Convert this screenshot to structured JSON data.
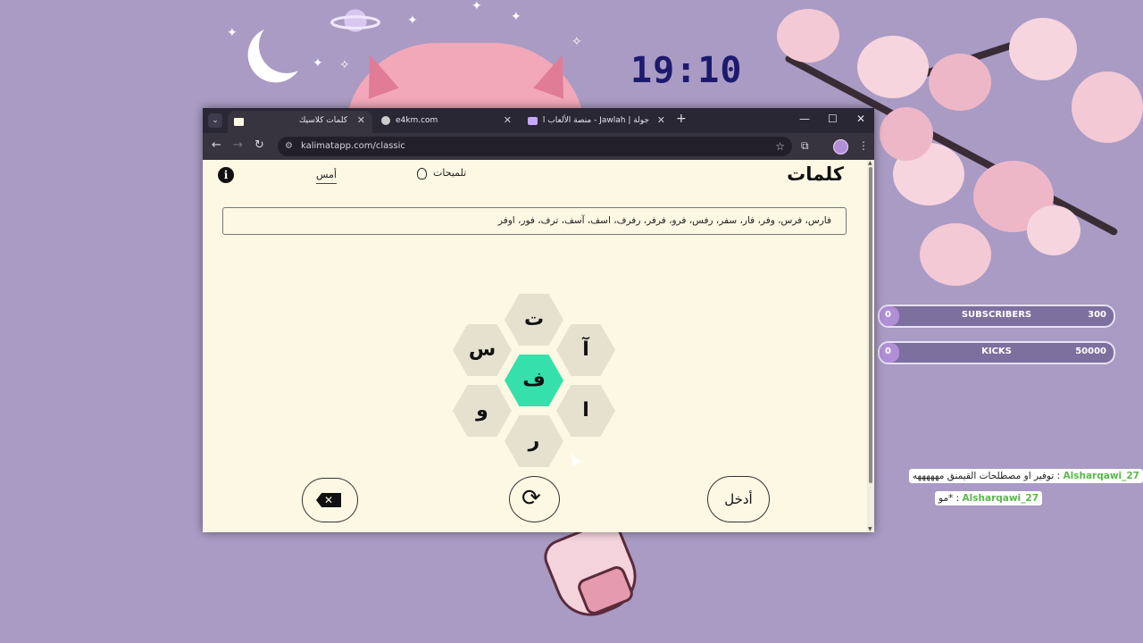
{
  "overlay": {
    "clock": "19:10",
    "goals": [
      {
        "current": "0",
        "label": "SUBSCRIBERS",
        "target": "300"
      },
      {
        "current": "0",
        "label": "KICKS",
        "target": "50000"
      }
    ],
    "chat": [
      {
        "user": "Alsharqawi_27",
        "separator": " : ",
        "message": "توفير او مصطلحات القيمنق مهههههه"
      },
      {
        "user": "Alsharqawi_27",
        "separator": " : ",
        "message": "*مو"
      }
    ]
  },
  "browser": {
    "tabs": [
      {
        "title": "كلمات كلاسيك",
        "close": "✕",
        "active": true
      },
      {
        "title": "e4km.com",
        "close": "✕",
        "active": false
      },
      {
        "title": "جولة | Jawlah - منصة الألعاب الت...",
        "close": "✕",
        "active": false
      }
    ],
    "new_tab": "+",
    "address": "kalimatapp.com/classic",
    "controls": {
      "minimize": "—",
      "maximize": "☐",
      "close": "✕",
      "back": "←",
      "forward": "→",
      "reload": "↻",
      "bookmark": "☆",
      "extensions": "⧉",
      "menu": "⋮",
      "tab_menu": "⌄"
    }
  },
  "app": {
    "logo": "كلمات",
    "hints_label": "تلميحات",
    "yesterday_label": "أمس",
    "info_label": "i",
    "found_words": "فارس، فرس، وفر، فار، سفر، رفس، فرو، فرفر، رفرف، اسف، آسف، ترف، فور، اوفر",
    "letters": {
      "center": "ف",
      "top": "ت",
      "top_right": "آ",
      "bottom_right": "ا",
      "bottom": "ر",
      "bottom_left": "و",
      "top_left": "س"
    },
    "enter_label": "أدخل",
    "delete_label": "✕",
    "shuffle_label": "⟳"
  },
  "colors": {
    "page_bg": "#fdf8e4",
    "center_hex": "#35e0aa",
    "outer_hex": "#e6e0cf",
    "desktop_bg": "#a99bc3"
  }
}
